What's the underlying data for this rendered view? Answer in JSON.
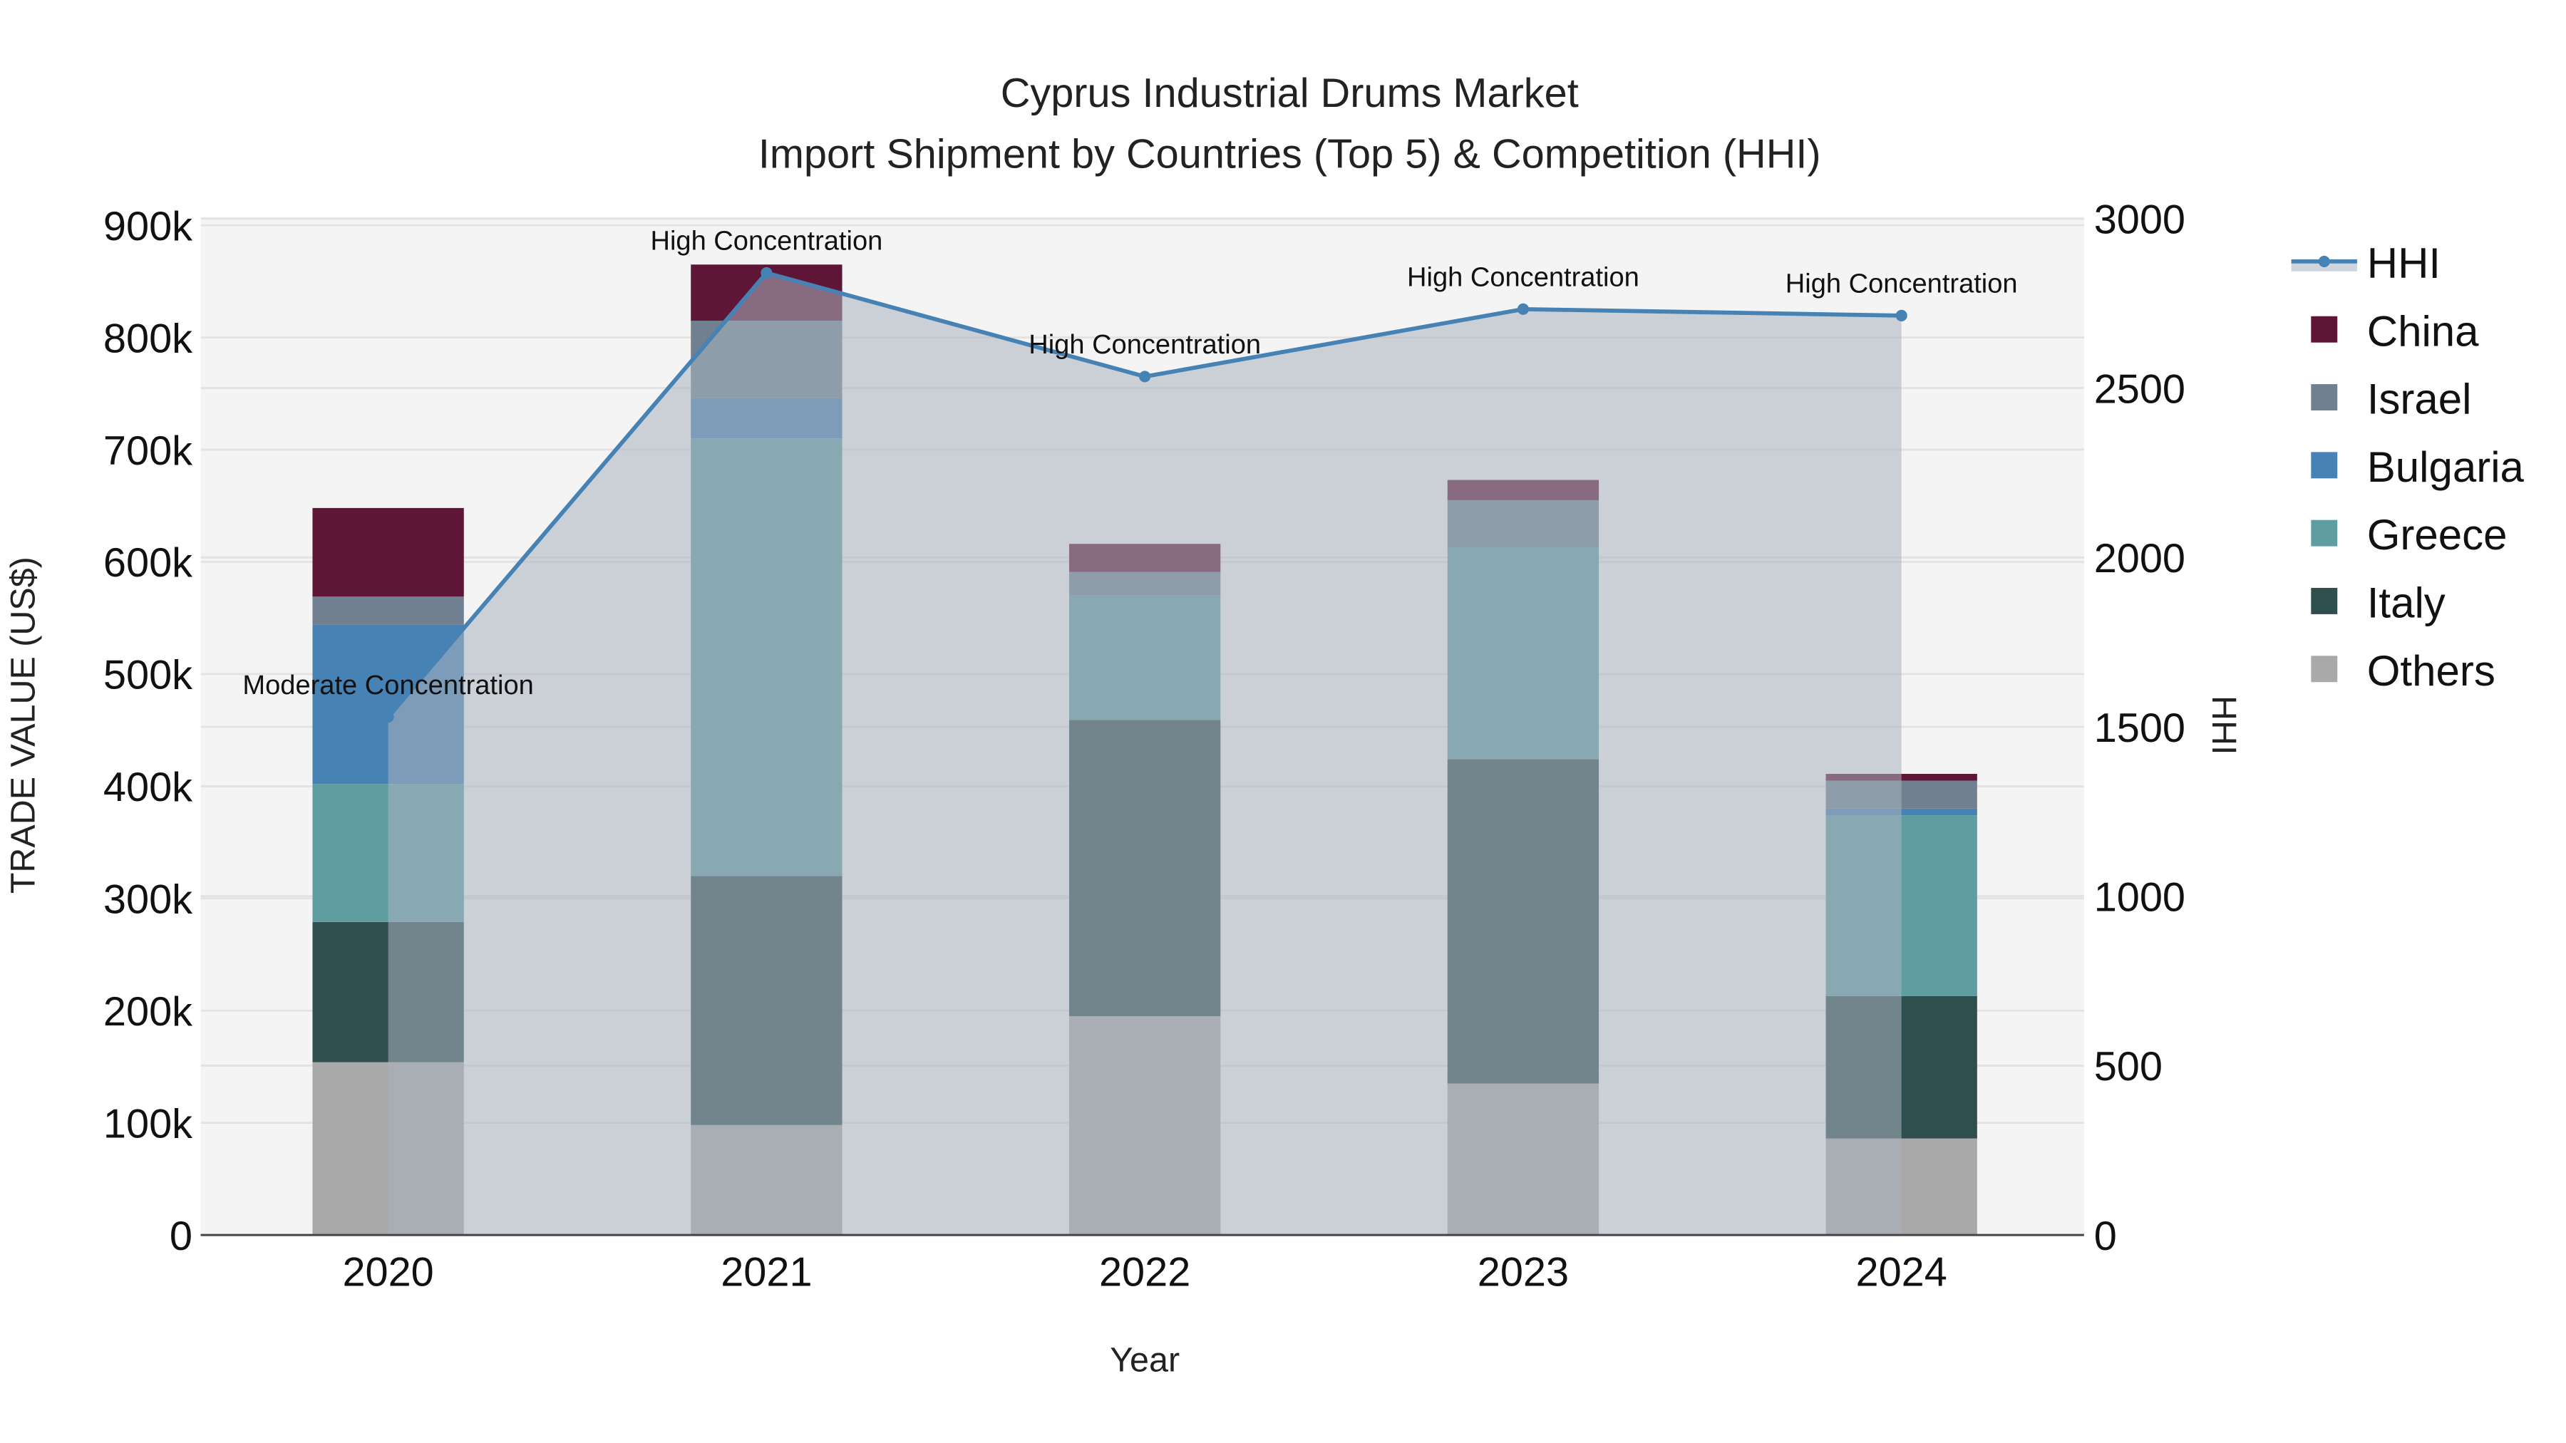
{
  "chart_data": {
    "type": "bar",
    "title": "Cyprus Industrial Drums Market",
    "subtitle": "Import Shipment by Countries (Top 5) & Competition (HHI)",
    "xlabel": "Year",
    "ylabel": "TRADE VALUE (US$)",
    "y2label": "HHI",
    "categories": [
      "2020",
      "2021",
      "2022",
      "2023",
      "2024"
    ],
    "ylim": [
      0,
      900000
    ],
    "y_ticks": [
      0,
      100000,
      200000,
      300000,
      400000,
      500000,
      600000,
      700000,
      800000,
      900000
    ],
    "y_tick_labels": [
      "0",
      "100k",
      "200k",
      "300k",
      "400k",
      "500k",
      "600k",
      "700k",
      "800k",
      "900k"
    ],
    "y2lim": [
      0,
      3000
    ],
    "y2_ticks": [
      0,
      500,
      1000,
      1500,
      2000,
      2500,
      3000
    ],
    "y2_tick_labels": [
      "0",
      "500",
      "1000",
      "1500",
      "2000",
      "2500",
      "3000"
    ],
    "grid": true,
    "legend_placement": "right",
    "series": [
      {
        "name": "Others",
        "color": "#a9a9a9",
        "values": [
          154000,
          98000,
          195000,
          135000,
          86000
        ]
      },
      {
        "name": "Italy",
        "color": "#2f4f4f",
        "values": [
          125000,
          222000,
          264000,
          289000,
          127000
        ]
      },
      {
        "name": "Greece",
        "color": "#5f9ea0",
        "values": [
          123000,
          390000,
          111000,
          189000,
          161000
        ]
      },
      {
        "name": "Bulgaria",
        "color": "#4682b4",
        "values": [
          142000,
          36000,
          0,
          0,
          6000
        ]
      },
      {
        "name": "Israel",
        "color": "#708090",
        "values": [
          25000,
          69000,
          21000,
          42000,
          25000
        ]
      },
      {
        "name": "China",
        "color": "#5f1535",
        "values": [
          79000,
          50000,
          25000,
          18000,
          6000
        ]
      }
    ],
    "hhi": {
      "name": "HHI",
      "color": "#4682b4",
      "values": [
        1529,
        2840,
        2534,
        2733,
        2714
      ],
      "annotations": [
        "Moderate Concentration",
        "High Concentration",
        "High Concentration",
        "High Concentration",
        "High Concentration"
      ]
    },
    "legend_order": [
      "HHI",
      "China",
      "Israel",
      "Bulgaria",
      "Greece",
      "Italy",
      "Others"
    ]
  }
}
